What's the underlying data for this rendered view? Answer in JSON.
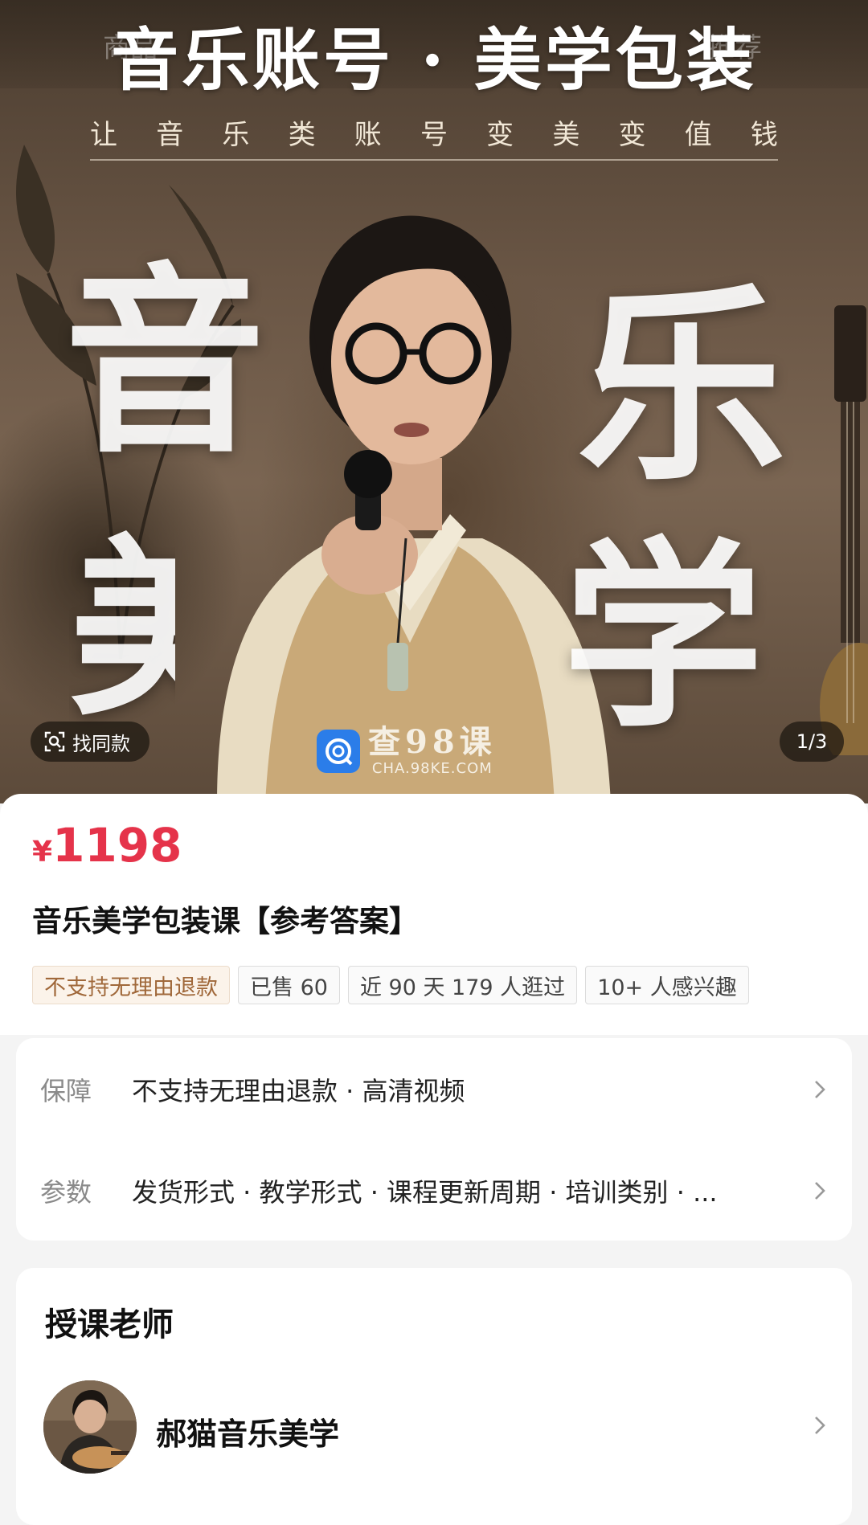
{
  "hero": {
    "ghost_tabs": [
      "商品",
      "推荐"
    ],
    "title": "音乐账号 · 美学包装",
    "subtitle_chars": [
      "让",
      "音",
      "乐",
      "类",
      "账",
      "号",
      "变",
      "美",
      "变",
      "值",
      "钱"
    ],
    "big_chars": [
      "音",
      "乐",
      "美",
      "学"
    ],
    "find_similar_label": "找同款",
    "page_counter": "1/3",
    "watermark_title": "查98课",
    "watermark_url": "CHA.98KE.COM"
  },
  "product": {
    "currency": "¥",
    "price": "1198",
    "title": "音乐美学包装课【参考答案】",
    "tags": [
      "不支持无理由退款",
      "已售 60",
      "近 90 天 179 人逛过",
      "10+ 人感兴趣"
    ]
  },
  "specs": {
    "guarantee_key": "保障",
    "guarantee_value": "不支持无理由退款 · 高清视频",
    "params_key": "参数",
    "params_value": "发货形式 · 教学形式 · 课程更新周期 · 培训类别 · ..."
  },
  "teacher": {
    "heading": "授课老师",
    "name": "郝猫音乐美学"
  },
  "colors": {
    "price": "#e5334a",
    "watermark_logo": "#2b7de9"
  },
  "icons": {
    "find_similar": "scan-icon",
    "chevron": "chevron-right-icon"
  }
}
